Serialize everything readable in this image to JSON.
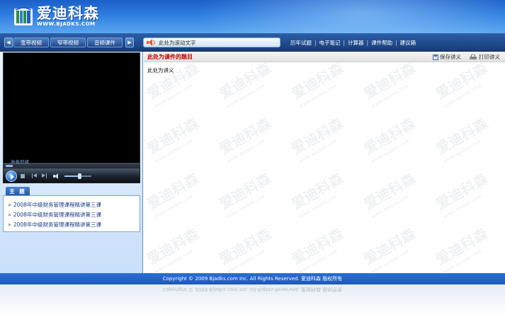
{
  "header": {
    "logo_cn": "爱迪科森",
    "logo_url": "WWW.BJADKS.COM"
  },
  "toolbar": {
    "media_tabs": [
      "宽带视频",
      "窄带视频",
      "音频课件"
    ],
    "marquee_text": "此处为滚动文字",
    "links": [
      "历年试题",
      "电子笔记",
      "计算器",
      "课件帮助",
      "建议箱"
    ]
  },
  "player": {
    "status": "准备就绪",
    "volume_level": 0.55
  },
  "topics": {
    "tab_label": "主 题",
    "items": [
      "2008年中级财务管理课程精讲第三课",
      "2008年中级财务管理课程精讲第三课",
      "2008年中级财务管理课程精讲第三课"
    ]
  },
  "lecture": {
    "title": "此处为课件的题目",
    "save_label": "保存讲义",
    "print_label": "打印讲义",
    "body": "此处为讲义",
    "watermark_cn": "爱迪科森",
    "watermark_url": "WWW.BJADKS.COM"
  },
  "footer": {
    "copyright": "Copyright © 2009 Bjadks.com Inc. All Rights Reserved. 爱迪科森 版权所有"
  },
  "colors": {
    "header_blue": "#2f7ee0",
    "toolbar_blue": "#173c78",
    "title_red": "#c00000",
    "footer_blue": "#1d58b8"
  }
}
